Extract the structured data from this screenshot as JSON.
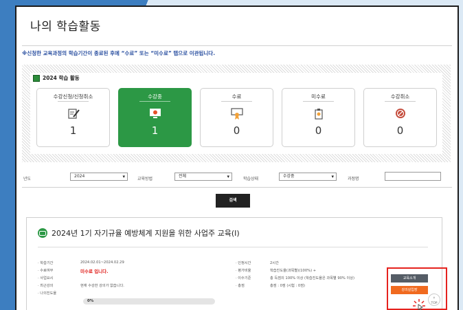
{
  "page": {
    "title": "나의 학습활동",
    "notice": "※신청한 교육과정의 학습기간이 종료된 후에 “수료” 또는 “미수료” 탭으로 이관됩니다.",
    "top_label": "TOP"
  },
  "summary": {
    "year_label": "2024 학습 활동",
    "cards": [
      {
        "label": "수강신청/신청취소",
        "count": "1",
        "icon": "edit-note-icon"
      },
      {
        "label": "수강중",
        "count": "1",
        "icon": "monitor-play-icon",
        "active": true
      },
      {
        "label": "수료",
        "count": "0",
        "icon": "certificate-icon"
      },
      {
        "label": "미수료",
        "count": "0",
        "icon": "clipboard-warning-icon"
      },
      {
        "label": "수강취소",
        "count": "0",
        "icon": "prohibited-icon"
      }
    ]
  },
  "filters": {
    "year_label": "년도",
    "year_value": "2024",
    "method_label": "교육방법",
    "method_value": "전체",
    "status_label": "학습상태",
    "status_value": "수강중",
    "course_label": "과정명",
    "course_value": "",
    "search_label": "검색"
  },
  "course": {
    "title": "2024년 1기 자기규율 예방체계 지원을 위한 사업주 교육(Ⅰ)",
    "left": [
      {
        "key": "· 학습기간",
        "value": "2024.02.01~2024.02.29"
      },
      {
        "key": "· 수료여부",
        "value": "미수료 입니다."
      },
      {
        "key": "· 사업요시",
        "value": ""
      },
      {
        "key": "· 최근강의",
        "value": "현재 수강한 강의가 없습니다."
      },
      {
        "key": "· 나의진도율",
        "value": ""
      }
    ],
    "progress": "0%",
    "right": [
      {
        "key": "· 인정시간",
        "value": "2시간"
      },
      {
        "key": "· 평가비율",
        "value": "학습진도율(과목별)(100%) +"
      },
      {
        "key": "· 이수기준",
        "value": "총 득점의 100% 이상 (학습진도율은 과목별 90% 이상)"
      },
      {
        "key": "· 총점",
        "value": "총점 : 0점 (시험 : 0점)"
      }
    ],
    "actions": {
      "intro": "교육소개",
      "enter": "강의실입장"
    }
  },
  "colors": {
    "active_card": "#2c9845",
    "notice_blue": "#2a4fa0",
    "highlight_red": "#e5211d",
    "enter_button": "#f06a1f",
    "intro_button": "#555d66"
  }
}
